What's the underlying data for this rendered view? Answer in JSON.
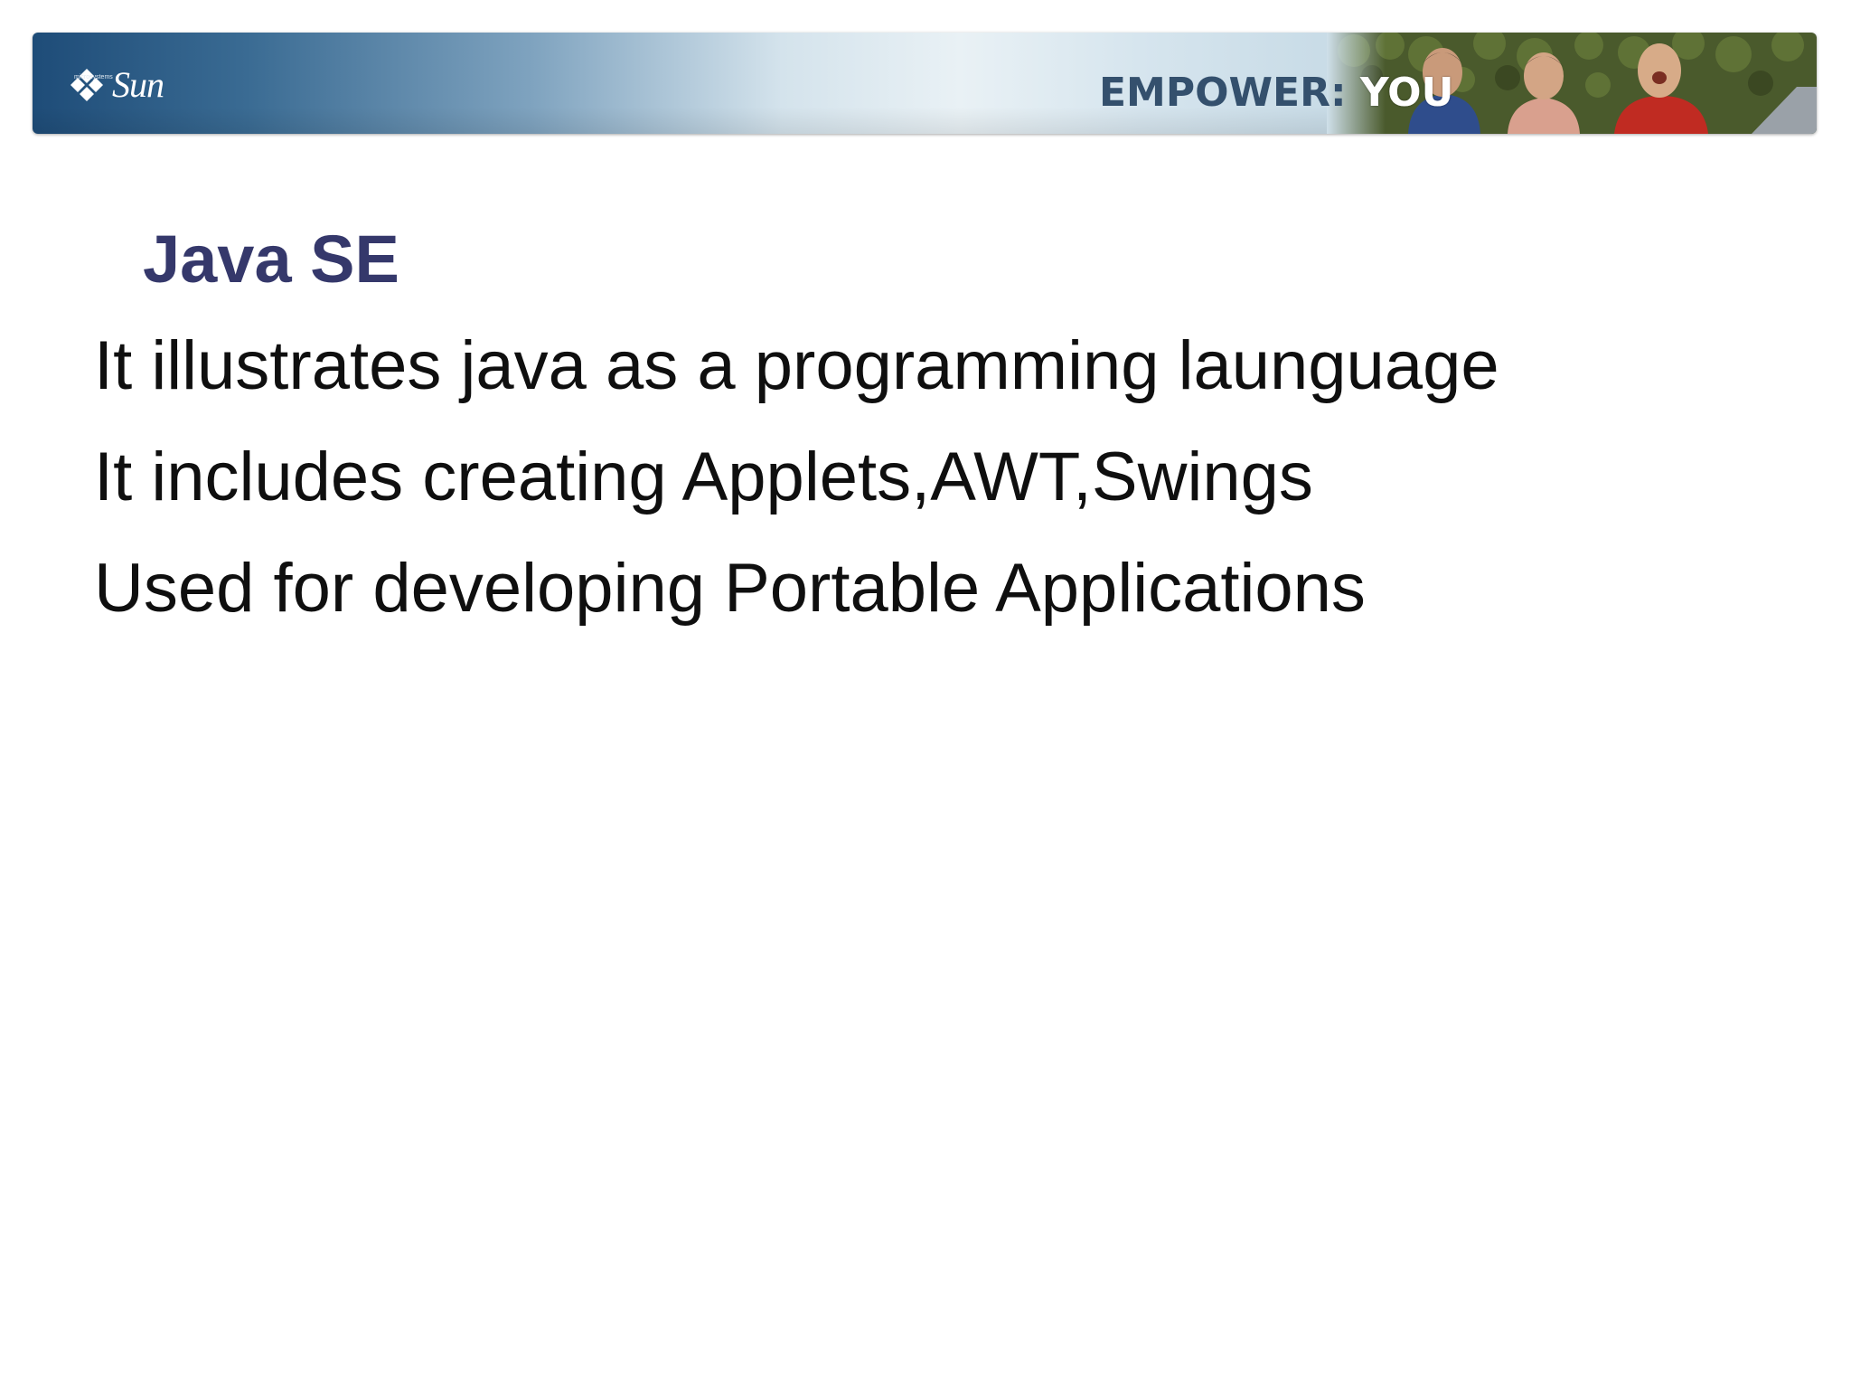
{
  "banner": {
    "logo_text": "Sun",
    "logo_tagline": "microsystems",
    "tagline_prefix": "EMPOWER:",
    "tagline_highlight": "YOU",
    "colors": {
      "banner_dark": "#1e4c78",
      "banner_light": "#e9f1f5",
      "tagline": "#34506d"
    }
  },
  "slide": {
    "title": "Java SE",
    "title_color": "#35386b",
    "bullets": [
      "It illustrates java as a programming launguage",
      "It includes creating Applets,AWT,Swings",
      "Used for developing Portable Applications"
    ]
  }
}
